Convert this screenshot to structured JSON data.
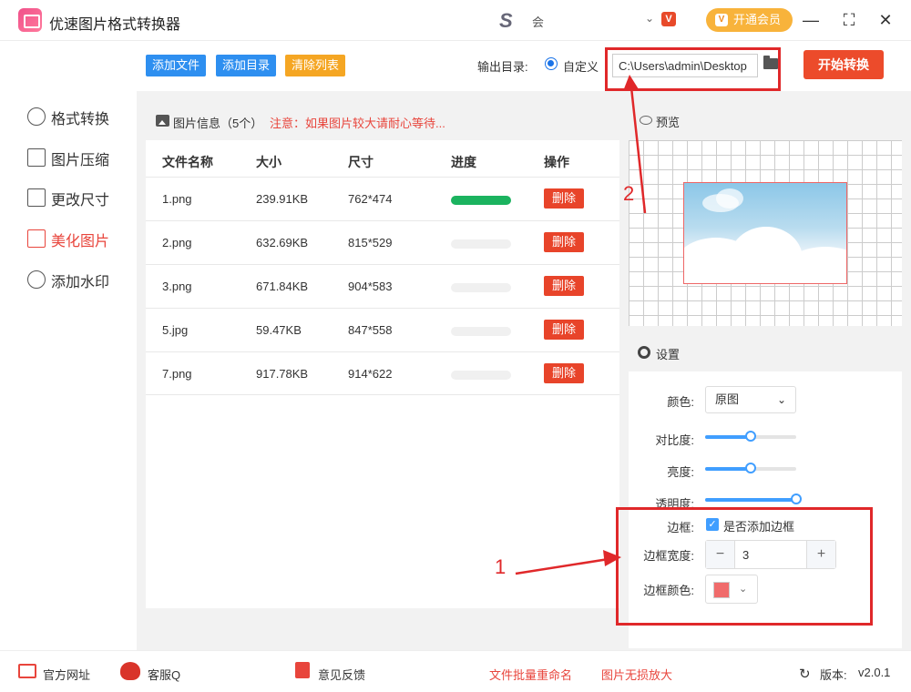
{
  "app": {
    "title": "优速图片格式转换器"
  },
  "account": {
    "name": "会",
    "vip_label": "开通会员"
  },
  "sidebar": {
    "items": [
      {
        "label": "格式转换",
        "icon": "swap-icon",
        "active": false
      },
      {
        "label": "图片压缩",
        "icon": "compress-icon",
        "active": false
      },
      {
        "label": "更改尺寸",
        "icon": "resize-icon",
        "active": false
      },
      {
        "label": "美化图片",
        "icon": "beautify-icon",
        "active": true
      },
      {
        "label": "添加水印",
        "icon": "watermark-icon",
        "active": false
      }
    ]
  },
  "toolbar": {
    "add_file": "添加文件",
    "add_dir": "添加目录",
    "clear_list": "清除列表",
    "output_label": "输出目录:",
    "output_mode": "自定义",
    "output_path": "C:\\Users\\admin\\Desktop",
    "start": "开始转换"
  },
  "list": {
    "info": "图片信息（5个）",
    "warning": "注意：如果图片较大请耐心等待...",
    "columns": [
      "文件名称",
      "大小",
      "尺寸",
      "进度",
      "操作"
    ],
    "delete_label": "删除",
    "rows": [
      {
        "name": "1.png",
        "size": "239.91KB",
        "dims": "762*474",
        "progress": 1.0
      },
      {
        "name": "2.png",
        "size": "632.69KB",
        "dims": "815*529",
        "progress": 0
      },
      {
        "name": "3.png",
        "size": "671.84KB",
        "dims": "904*583",
        "progress": 0
      },
      {
        "name": "5.jpg",
        "size": "59.47KB",
        "dims": "847*558",
        "progress": 0
      },
      {
        "name": "7.png",
        "size": "917.78KB",
        "dims": "914*622",
        "progress": 0
      }
    ]
  },
  "preview": {
    "title": "预览"
  },
  "settings": {
    "title": "设置",
    "color_label": "颜色:",
    "color_value": "原图",
    "contrast_label": "对比度:",
    "contrast": 0.5,
    "brightness_label": "亮度:",
    "brightness": 0.5,
    "opacity_label": "透明度:",
    "opacity": 1.0,
    "border_label": "边框:",
    "border_check": "是否添加边框",
    "border_width_label": "边框宽度:",
    "border_width": "3",
    "border_color_label": "边框颜色:",
    "border_color": "#f06b6b"
  },
  "annotations": {
    "one": "1",
    "two": "2"
  },
  "footer": {
    "site": "官方网址",
    "service": "客服Q",
    "feedback": "意见反馈",
    "rename": "文件批量重命名",
    "enlarge": "图片无损放大",
    "version_label": "版本:",
    "version": "v2.0.1"
  },
  "colors": {
    "accent": "#409eff",
    "danger": "#e8442a",
    "active": "#e8453c",
    "progress": "#1bb35f"
  }
}
